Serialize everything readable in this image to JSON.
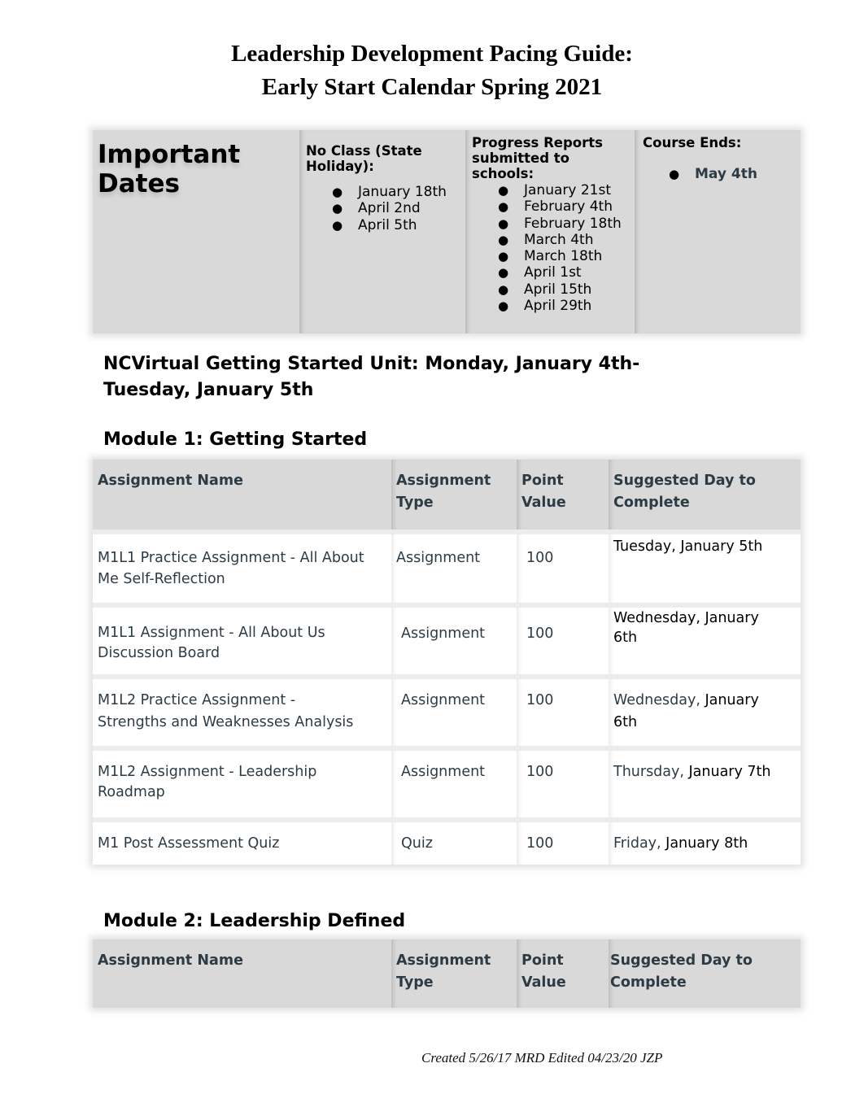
{
  "title": {
    "line1": "Leadership Development Pacing Guide:",
    "line2": "Early Start Calendar Spring 2021"
  },
  "important_dates": {
    "heading_line1": "Important",
    "heading_line2": "Dates",
    "no_class": {
      "heading_line1": "No Class (State",
      "heading_line2": "Holiday):",
      "dates": [
        "January 18th",
        "April 2nd",
        "April 5th"
      ]
    },
    "progress_reports": {
      "heading_line1": "Progress Reports",
      "heading_line2": "submitted to",
      "heading_line3": "schools:",
      "dates": [
        "January 21st",
        "February 4th",
        "February 18th",
        "March 4th",
        "March 18th",
        "April 1st",
        "April 15th",
        "April 29th"
      ]
    },
    "course_ends": {
      "heading": "Course Ends:",
      "dates": [
        "May 4th"
      ]
    }
  },
  "getting_started_unit": {
    "line1": "NCVirtual Getting Started Unit:  Monday, January 4th-",
    "line2": "Tuesday, January 5th"
  },
  "modules": [
    {
      "title": "Module 1:  Getting Started",
      "columns": {
        "name_line1": "Assignment Name",
        "type_line1": "Assignment",
        "type_line2": "Type",
        "points_line1": "Point",
        "points_line2": "Value",
        "day_line1": "Suggested Day to",
        "day_line2": "Complete"
      },
      "rows": [
        {
          "name_line1": "M1L1 Practice Assignment - All About",
          "name_line2": "Me Self-Reflection",
          "type": "Assignment",
          "points": "100",
          "day_weekday": "Tuesday,",
          "day_date": " January 5th",
          "day_line2": ""
        },
        {
          "name_line1": "M1L1 Assignment - All About Us",
          "name_line2": "Discussion Board",
          "type": "Assignment",
          "points": "100",
          "day_weekday": "Wednesday,",
          "day_date": " January",
          "day_line2": "6th"
        },
        {
          "name_line1": "M1L2 Practice Assignment -",
          "name_line2": "Strengths and Weaknesses Analysis",
          "type": "Assignment",
          "points": "100",
          "day_weekday": "Wednesday,",
          "day_date": " January",
          "day_line2": "6th"
        },
        {
          "name_line1": "M1L2 Assignment - Leadership",
          "name_line2": "Roadmap",
          "type": "Assignment",
          "points": "100",
          "day_weekday": "Thursday,",
          "day_date": " January 7th",
          "day_line2": ""
        },
        {
          "name_line1": "M1 Post Assessment Quiz",
          "name_line2": "",
          "type": "Quiz",
          "points": "100",
          "day_weekday": "Friday,",
          "day_date": " January 8th",
          "day_line2": ""
        }
      ]
    },
    {
      "title": "Module 2:  Leadership Defined",
      "columns": {
        "name_line1": "Assignment Name",
        "type_line1": "Assignment",
        "type_line2": "Type",
        "points_line1": "Point",
        "points_line2": "Value",
        "day_line1": "Suggested Day to",
        "day_line2": "Complete"
      },
      "rows": []
    }
  ],
  "footer": "Created 5/26/17 MRD  Edited 04/23/20 JZP"
}
